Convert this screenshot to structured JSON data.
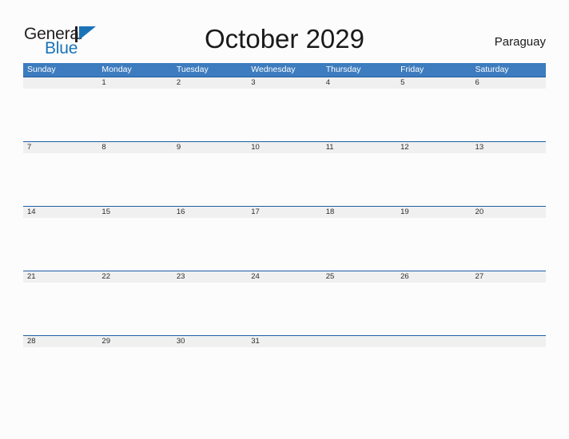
{
  "brand": {
    "name_part1": "General",
    "name_part2": "Blue",
    "flag_icon": "blue-triangle-flag-icon",
    "colors": {
      "dark_text": "#231f20",
      "blue": "#1a73b7"
    }
  },
  "header": {
    "title": "October 2029",
    "country": "Paraguay"
  },
  "calendar": {
    "month": "October",
    "year": "2029",
    "colors": {
      "weekday_header_bg": "#3d7cbe",
      "weekday_header_text": "#ffffff",
      "row_rule": "#1f5fa3",
      "date_band_bg": "#f0f0f0",
      "page_bg": "#fcfcfd"
    },
    "weekdays": [
      "Sunday",
      "Monday",
      "Tuesday",
      "Wednesday",
      "Thursday",
      "Friday",
      "Saturday"
    ],
    "weeks": [
      [
        "",
        "1",
        "2",
        "3",
        "4",
        "5",
        "6"
      ],
      [
        "7",
        "8",
        "9",
        "10",
        "11",
        "12",
        "13"
      ],
      [
        "14",
        "15",
        "16",
        "17",
        "18",
        "19",
        "20"
      ],
      [
        "21",
        "22",
        "23",
        "24",
        "25",
        "26",
        "27"
      ],
      [
        "28",
        "29",
        "30",
        "31",
        "",
        "",
        ""
      ]
    ]
  }
}
